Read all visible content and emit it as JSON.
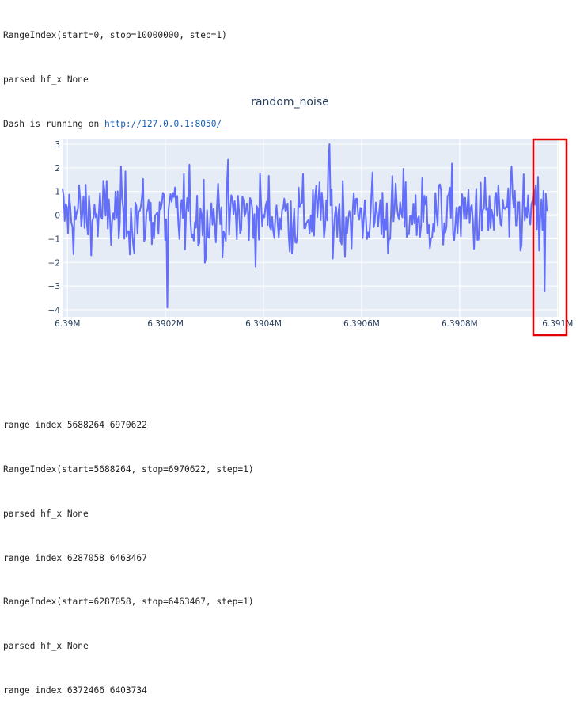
{
  "top_log": [
    "RangeIndex(start=0, stop=10000000, step=1)",
    "parsed hf_x None"
  ],
  "running": {
    "prefix": "Dash is running on ",
    "url": "http://127.0.0.1:8050/"
  },
  "bottom_log": [
    "range index 5688264 6970622",
    "RangeIndex(start=5688264, stop=6970622, step=1)",
    "parsed hf_x None",
    "range index 6287058 6463467",
    "RangeIndex(start=6287058, stop=6463467, step=1)",
    "parsed hf_x None",
    "range index 6372466 6403734"
  ],
  "colors": {
    "line": "#636efa",
    "plot_bg": "#e5ecf6",
    "highlight": "#e00000"
  },
  "chart_data": {
    "type": "line",
    "title": "random_noise",
    "xlabel": "",
    "ylabel": "",
    "x_ticks": [
      "6.39M",
      "6.3902M",
      "6.3904M",
      "6.3906M",
      "6.3908M",
      "6.391M"
    ],
    "x_tick_values": [
      6390000,
      6390200,
      6390400,
      6390600,
      6390800,
      6391000
    ],
    "y_ticks": [
      "3",
      "2",
      "1",
      "0",
      "−1",
      "−2",
      "−3",
      "−4"
    ],
    "y_tick_values": [
      3,
      2,
      1,
      0,
      -1,
      -2,
      -3,
      -4
    ],
    "xlim": [
      6389990,
      6391002
    ],
    "ylim": [
      -4.3,
      3.2
    ],
    "grid": true,
    "series": [
      {
        "x_start": 6389990,
        "x_end": 6390978,
        "y_min": -3.9,
        "y_max": 3.0
      }
    ]
  }
}
